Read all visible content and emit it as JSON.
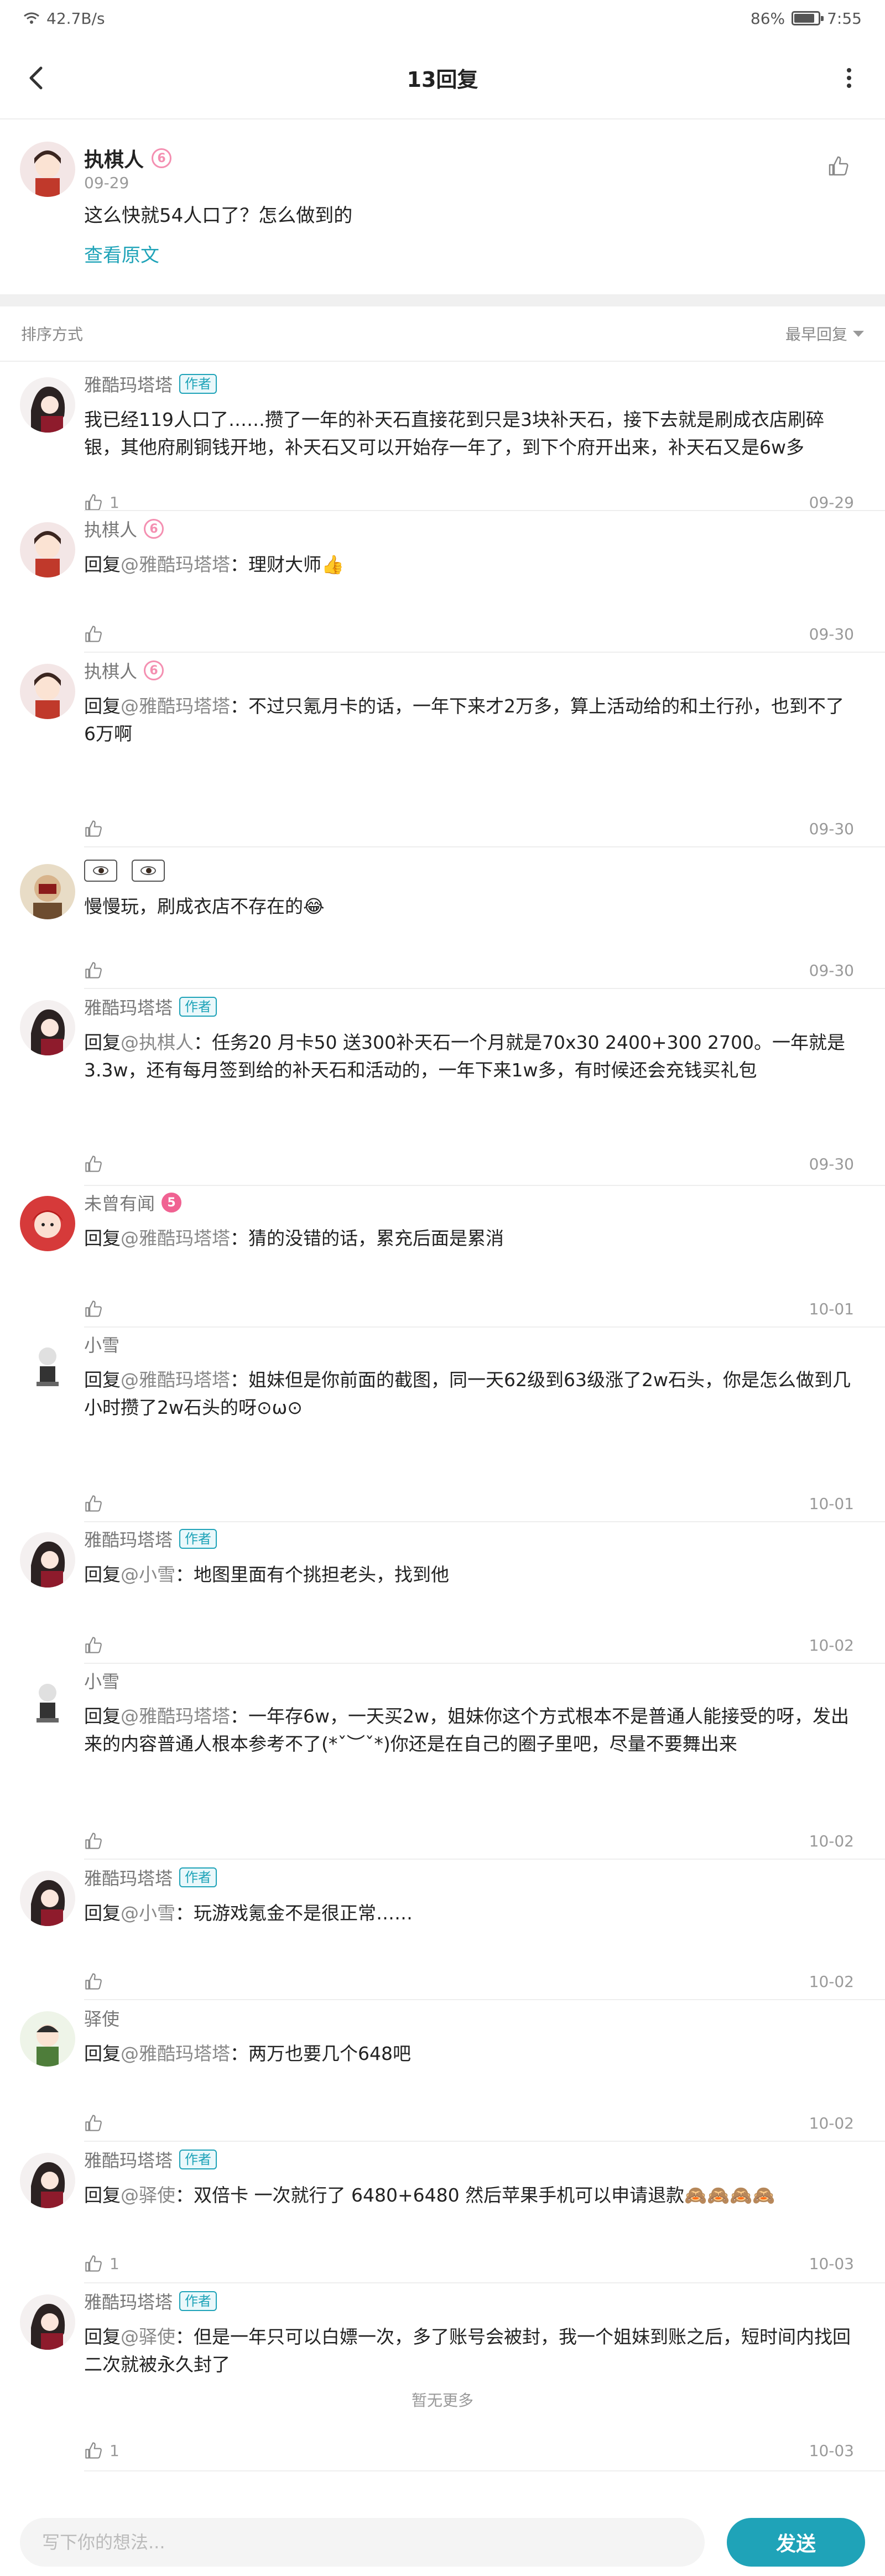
{
  "status_bar": {
    "network_speed": "42.7B/s",
    "battery": "86%",
    "battery_level": 0.86,
    "time": "7:55"
  },
  "nav": {
    "title": "13回复"
  },
  "original_post": {
    "user": "执棋人",
    "level_badge": "6",
    "date": "09-29",
    "text": "这么快就54人口了？怎么做到的",
    "view_original": "查看原文"
  },
  "sort": {
    "label": "排序方式",
    "selected": "最早回复"
  },
  "replies": [
    {
      "user": "雅酷玛塔塔",
      "author_badge": "作者",
      "prefix": "",
      "target": "",
      "text": "我已经119人口了……攒了一年的补天石直接花到只是3块补天石，接下去就是刷成衣店刷碎银，其他府刷铜钱开地，补天石又可以开始存一年了，到下个府开出来，补天石又是6w多",
      "likes": "1",
      "date": "09-29"
    },
    {
      "user": "执棋人",
      "level_badge": "6",
      "prefix": "回复",
      "target": "@雅酷玛塔塔",
      "text": "：理财大师👍",
      "likes": "",
      "date": "09-30"
    },
    {
      "user": "执棋人",
      "level_badge": "6",
      "prefix": "回复",
      "target": "@雅酷玛塔塔",
      "text": "：不过只氪月卡的话，一年下来才2万多，算上活动给的和土行孙，也到不了6万啊",
      "likes": "",
      "date": "09-30"
    },
    {
      "user": "",
      "prefix": "",
      "target": "",
      "text": "慢慢玩，刷成衣店不存在的😂",
      "likes": "",
      "date": "09-30"
    },
    {
      "user": "雅酷玛塔塔",
      "author_badge": "作者",
      "prefix": "回复",
      "target": "@执棋人",
      "text": "：任务20 月卡50 送300补天石一个月就是70x30 2400+300  2700。一年就是3.3w，还有每月签到给的补天石和活动的，一年下来1w多，有时候还会充钱买礼包",
      "likes": "",
      "date": "09-30"
    },
    {
      "user": "未曾有闻",
      "level_badge": "5",
      "prefix": "回复",
      "target": "@雅酷玛塔塔",
      "text": "：猜的没错的话，累充后面是累消",
      "likes": "",
      "date": "10-01"
    },
    {
      "user": "小雪",
      "prefix": "回复",
      "target": "@雅酷玛塔塔",
      "text": "：姐妹但是你前面的截图，同一天62级到63级涨了2w石头，你是怎么做到几小时攒了2w石头的呀⊙ω⊙",
      "likes": "",
      "date": "10-01"
    },
    {
      "user": "雅酷玛塔塔",
      "author_badge": "作者",
      "prefix": "回复",
      "target": "@小雪",
      "text": "：地图里面有个挑担老头，找到他",
      "likes": "",
      "date": "10-02"
    },
    {
      "user": "小雪",
      "prefix": "回复",
      "target": "@雅酷玛塔塔",
      "text": "：一年存6w，一天买2w，姐妹你这个方式根本不是普通人能接受的呀，发出来的内容普通人根本参考不了(*ˇ︶ˇ*)你还是在自己的圈子里吧，尽量不要舞出来",
      "likes": "",
      "date": "10-02"
    },
    {
      "user": "雅酷玛塔塔",
      "author_badge": "作者",
      "prefix": "回复",
      "target": "@小雪",
      "text": "：玩游戏氪金不是很正常……",
      "likes": "",
      "date": "10-02"
    },
    {
      "user": "驿使",
      "prefix": "回复",
      "target": "@雅酷玛塔塔",
      "text": "：两万也要几个648吧",
      "likes": "",
      "date": "10-02"
    },
    {
      "user": "雅酷玛塔塔",
      "author_badge": "作者",
      "prefix": "回复",
      "target": "@驿使",
      "text": "：双倍卡 一次就行了  6480+6480 然后苹果手机可以申请退款🙈🙈🙈🙈",
      "likes": "1",
      "date": "10-03"
    },
    {
      "user": "雅酷玛塔塔",
      "author_badge": "作者",
      "prefix": "回复",
      "target": "@驿使",
      "text": "：但是一年只可以白嫖一次，多了账号会被封，我一个姐妹到账之后，短时间内找回二次就被永久封了",
      "likes": "1",
      "date": "10-03"
    }
  ],
  "no_more": "暂无更多",
  "composer": {
    "placeholder": "写下你的想法...",
    "send_label": "发送"
  },
  "colors": {
    "accent": "#1fa3b8",
    "badge_pink": "#f06292"
  },
  "icons": [
    "back-arrow-icon",
    "more-vertical-icon",
    "thumbs-up-icon",
    "wifi-icon",
    "battery-icon",
    "caret-down-icon"
  ]
}
